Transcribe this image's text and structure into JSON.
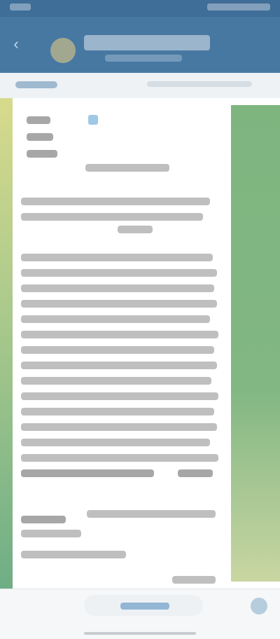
{
  "window": {
    "title": ""
  },
  "composer": {
    "placeholder": ""
  },
  "colors": {
    "header": "#4778a2",
    "status_bar": "#3f6e98",
    "accent_green": "#7eb57f",
    "accent_lime": "#d7da8c"
  },
  "icons": {
    "back": "back-icon",
    "send": "send-icon"
  }
}
